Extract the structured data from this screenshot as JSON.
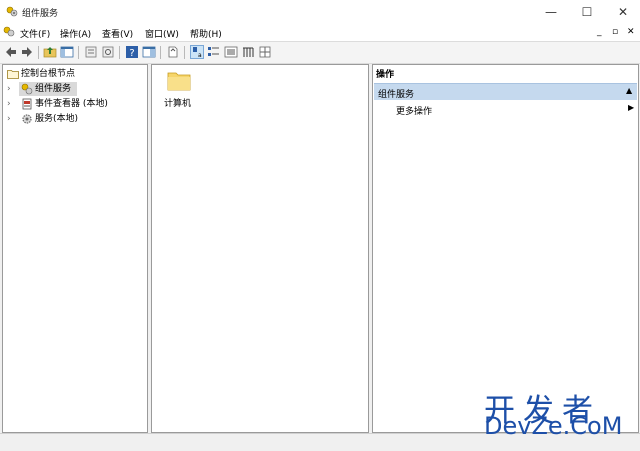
{
  "window": {
    "title": "组件服务",
    "minimize_glyph": "—",
    "maximize_glyph": "☐",
    "close_glyph": "✕"
  },
  "menu": {
    "items": [
      "文件(F)",
      "操作(A)",
      "查看(V)",
      "窗口(W)",
      "帮助(H)"
    ],
    "mdi_minimize": "_",
    "mdi_restore": "▫",
    "mdi_close": "✕"
  },
  "tree": {
    "root": "控制台根节点",
    "items": [
      {
        "label": "组件服务",
        "icon": "component-services-icon",
        "selected": true
      },
      {
        "label": "事件查看器 (本地)",
        "icon": "event-viewer-icon"
      },
      {
        "label": "服务(本地)",
        "icon": "services-gear-icon"
      }
    ]
  },
  "center": {
    "items": [
      {
        "label": "计算机",
        "icon": "folder-icon"
      }
    ]
  },
  "actions": {
    "header": "操作",
    "section": "组件服务",
    "more_actions": "更多操作"
  },
  "watermark": {
    "line1": "开发者",
    "line2": "DevZe.CoM"
  },
  "colors": {
    "action_section_bg": "#c5d9ee",
    "selected_bg": "#d9d9d9",
    "folder_yellow": "#f6d56b",
    "watermark_blue": "#1d4fa8"
  }
}
